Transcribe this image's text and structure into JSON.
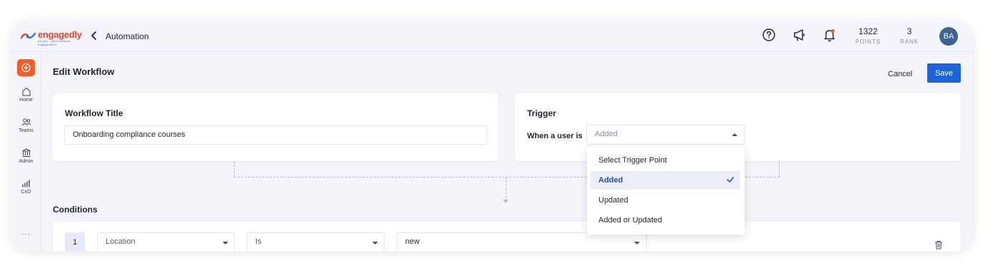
{
  "brand": {
    "logo_text": "engagedly",
    "logo_tagline": "people · performance · engagement",
    "accent": "#f25c26",
    "primary": "#1b64da"
  },
  "header": {
    "breadcrumb": "Automation",
    "points": {
      "value": "1322",
      "label": "POINTS"
    },
    "rank": {
      "value": "3",
      "label": "RANK"
    },
    "avatar_initials": "BA",
    "icons": [
      "help-icon",
      "announcement-icon",
      "notification-bell-icon"
    ]
  },
  "sidebar": {
    "items": [
      {
        "label": "Home",
        "icon": "home-icon"
      },
      {
        "label": "Teams",
        "icon": "teams-icon"
      },
      {
        "label": "Admin",
        "icon": "admin-icon"
      },
      {
        "label": "CxO",
        "icon": "chart-icon"
      }
    ],
    "more": "···"
  },
  "page": {
    "title": "Edit Workflow",
    "cancel_label": "Cancel",
    "save_label": "Save"
  },
  "workflow": {
    "title_label": "Workflow Title",
    "title_value": "Onboarding compliance courses"
  },
  "trigger": {
    "title": "Trigger",
    "field_label": "When a user is",
    "selected": "Added",
    "options": [
      "Select Trigger Point",
      "Added",
      "Updated",
      "Added or Updated"
    ],
    "selected_index": 1
  },
  "conditions": {
    "title": "Conditions",
    "rows": [
      {
        "index": "1",
        "field": "Location",
        "operator": "Is",
        "value": "new"
      }
    ]
  }
}
